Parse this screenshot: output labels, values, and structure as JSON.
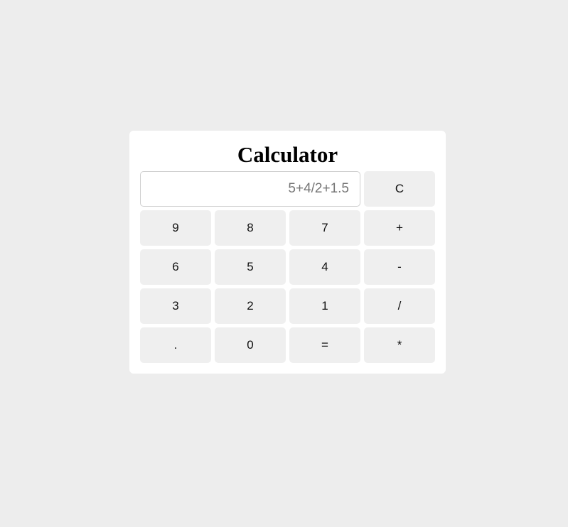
{
  "calculator": {
    "title": "Calculator",
    "display": {
      "value": "",
      "placeholder": "5+4/2+1.5"
    },
    "clear_label": "C",
    "keys": [
      [
        "9",
        "8",
        "7",
        "+"
      ],
      [
        "6",
        "5",
        "4",
        "-"
      ],
      [
        "3",
        "2",
        "1",
        "/"
      ],
      [
        ".",
        "0",
        "=",
        "*"
      ]
    ]
  },
  "colors": {
    "page_background": "#ededed",
    "panel_background": "#ffffff",
    "button_background": "#efefef",
    "display_border": "#cfcfcf",
    "placeholder_text": "#757575"
  }
}
